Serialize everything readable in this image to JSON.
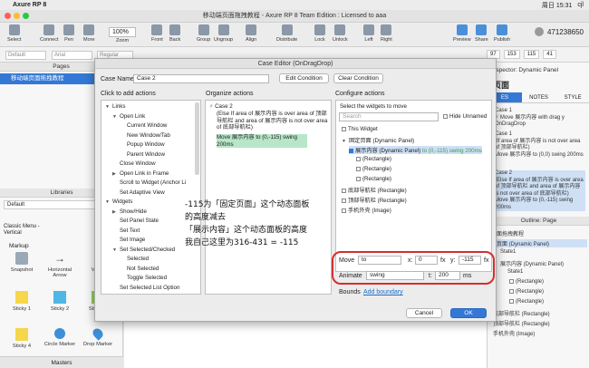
{
  "menubar": {
    "app": "Axure RP 8",
    "clock": "周日 15:31",
    "user": "cjl"
  },
  "window": {
    "title": "移动端页面拖拽教程 - Axure RP 8 Team Edition : Licensed to aaa"
  },
  "toolbar": {
    "items": [
      "Select",
      "Connect",
      "Pen",
      "More",
      "Zoom",
      "Front",
      "Back",
      "Group",
      "Ungroup",
      "Align",
      "Distribute",
      "Lock",
      "Unlock",
      "Left",
      "Right",
      "Preview",
      "Share",
      "Publish"
    ],
    "zoom": "100%",
    "account": "471238650"
  },
  "format": {
    "style": "Default",
    "font": "Arial",
    "weight": "Regular"
  },
  "coords": {
    "x": "97",
    "y": "153",
    "w": "115",
    "h": "41"
  },
  "left": {
    "pages_title": "Pages",
    "page": "移动端页面拖拽教程",
    "libraries_title": "Libraries",
    "library_select": "Default",
    "classic_menu": "Classic Menu - Vertical",
    "markup": "Markup",
    "widgets": [
      {
        "label": "Snapshot"
      },
      {
        "label": "Horizontal Arrow"
      },
      {
        "label": "Vertic"
      },
      {
        "label": "Sticky 1"
      },
      {
        "label": "Sticky 2"
      },
      {
        "label": "Sticky 3"
      },
      {
        "label": "Sticky 4"
      },
      {
        "label": "Circle Marker"
      },
      {
        "label": "Drop Marker"
      }
    ],
    "masters_title": "Masters"
  },
  "right": {
    "inspector": "Inspector: Dynamic Panel",
    "big_title": "页面",
    "tabs": [
      "ES",
      "NOTES",
      "STYLE"
    ],
    "case1": "Case 1",
    "case1_move": "Move 展示内容 with drag y",
    "ondragdrop": "OnDragDrop",
    "case1b": "Case 1",
    "case1b_cond": "(If area of 展示内容 is not over area of 顶部导航栏)",
    "case1b_move": "Move 展示内容 to (0,0) swing 200ms",
    "case2": "Case 2",
    "case2_cond": "(Else If area of 展示内容 is over area of 顶部导航栏 and area of 展示内容 is not over area of 底部导航栏)",
    "case2_move": "Move 展示内容 to (0,-115) swing 200ms",
    "outline_title": "Outline: Page",
    "outline": {
      "root": "面拖拽教程",
      "fixed_page": "页面 (Dynamic Panel)",
      "state1": "State1",
      "content": "展示内容 (Dynamic Panel)",
      "content_state": "State1",
      "rect": "(Rectangle)",
      "bottom_nav": "底部导航栏 (Rectangle)",
      "top_nav": "顶部导航栏 (Rectangle)",
      "phone": "手机外壳 (Image)"
    }
  },
  "dialog": {
    "title": "Case Editor (OnDragDrop)",
    "case_name_label": "Case Name",
    "case_name": "Case 2",
    "edit_condition": "Edit Condition",
    "clear_condition": "Clear Condition",
    "col1_title": "Click to add actions",
    "col2_title": "Organize actions",
    "col3_title": "Configure actions",
    "actions": [
      {
        "label": "Links",
        "level": 0,
        "tri": "▼"
      },
      {
        "label": "Open Link",
        "level": 1,
        "tri": "▼"
      },
      {
        "label": "Current Window",
        "level": 2,
        "tri": ""
      },
      {
        "label": "New Window/Tab",
        "level": 2,
        "tri": ""
      },
      {
        "label": "Popup Window",
        "level": 2,
        "tri": ""
      },
      {
        "label": "Parent Window",
        "level": 2,
        "tri": ""
      },
      {
        "label": "Close Window",
        "level": 1,
        "tri": ""
      },
      {
        "label": "Open Link in Frame",
        "level": 1,
        "tri": "▶"
      },
      {
        "label": "Scroll to Widget (Anchor Li",
        "level": 1,
        "tri": ""
      },
      {
        "label": "Set Adaptive View",
        "level": 1,
        "tri": ""
      },
      {
        "label": "Widgets",
        "level": 0,
        "tri": "▼"
      },
      {
        "label": "Show/Hide",
        "level": 1,
        "tri": "▶"
      },
      {
        "label": "Set Panel State",
        "level": 1,
        "tri": ""
      },
      {
        "label": "Set Text",
        "level": 1,
        "tri": ""
      },
      {
        "label": "Set Image",
        "level": 1,
        "tri": ""
      },
      {
        "label": "Set Selected/Checked",
        "level": 1,
        "tri": "▼"
      },
      {
        "label": "Selected",
        "level": 2,
        "tri": ""
      },
      {
        "label": "Not Selected",
        "level": 2,
        "tri": ""
      },
      {
        "label": "Toggle Selected",
        "level": 2,
        "tri": ""
      },
      {
        "label": "Set Selected List Option",
        "level": 1,
        "tri": ""
      }
    ],
    "organize": {
      "case": "Case 2",
      "cond": "(Else If area of 展示内容 is over area of 顶部导航栏 and area of 展示内容 is not over area of 底部导航栏)",
      "move": "Move 展示内容 to (0,-115) swing 200ms"
    },
    "select_label": "Select the widgets to move",
    "search_placeholder": "Search",
    "hide_unnamed": "Hide Unnamed",
    "widget_tree": [
      {
        "label": "This Widget",
        "indent": 0,
        "checked": false,
        "green": ""
      },
      {
        "label": "固定页面 (Dynamic Panel)",
        "indent": 0,
        "checked": null,
        "green": ""
      },
      {
        "label": "展示内容 (Dynamic Panel)",
        "indent": 1,
        "checked": true,
        "green": " to (0,-115) swing 200ms"
      },
      {
        "label": "(Rectangle)",
        "indent": 2,
        "checked": false,
        "green": ""
      },
      {
        "label": "(Rectangle)",
        "indent": 2,
        "checked": false,
        "green": ""
      },
      {
        "label": "(Rectangle)",
        "indent": 2,
        "checked": false,
        "green": ""
      },
      {
        "label": "底部导航栏 (Rectangle)",
        "indent": 0,
        "checked": false,
        "green": ""
      },
      {
        "label": "顶部导航栏 (Rectangle)",
        "indent": 0,
        "checked": false,
        "green": ""
      },
      {
        "label": "手机外壳 (Image)",
        "indent": 0,
        "checked": false,
        "green": ""
      }
    ],
    "move_label": "Move",
    "move_type": "to",
    "x_label": "x:",
    "x_value": "0",
    "y_label": "y:",
    "y_value": "-115",
    "fx": "fx",
    "animate_label": "Animate",
    "animate_type": "swing",
    "t_label": "t:",
    "t_value": "200",
    "ms": "ms",
    "bounds_label": "Bounds",
    "add_boundary": "Add boundary",
    "cancel": "Cancel",
    "ok": "OK"
  },
  "annotation": {
    "line1": "-115为「固定页面」这个动态面板",
    "line2": "的高度减去",
    "line3": "「展示内容」这个动态面板的高度",
    "line4": "我自己这里为316-431 = -115"
  },
  "colors": {
    "selection": "#3478d6",
    "highlight": "#b7e6c8",
    "annotation_box": "#d32f2f"
  }
}
